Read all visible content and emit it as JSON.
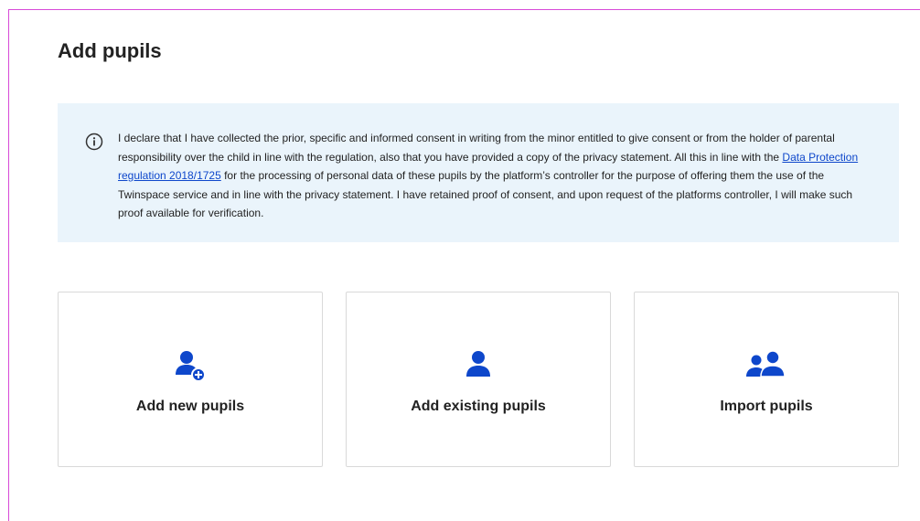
{
  "page": {
    "title": "Add pupils"
  },
  "notice": {
    "icon": "info-circle-icon",
    "text_before_link": "I declare that I have collected the prior, specific and informed consent in writing from the minor entitled to give consent or from the holder of parental responsibility over the child in line with the regulation, also that you have provided a copy of the privacy statement. All this in line with the ",
    "link_text": "Data Protection regulation 2018/1725",
    "text_after_link": " for the processing of personal data of these pupils by the platform’s controller for the purpose of offering them the use of the Twinspace service and in line with the privacy statement. I have retained proof of consent, and upon request of the platforms controller, I will make such proof available for verification."
  },
  "cards": [
    {
      "label": "Add new pupils",
      "icon": "user-plus-icon"
    },
    {
      "label": "Add existing pupils",
      "icon": "user-icon"
    },
    {
      "label": "Import pupils",
      "icon": "users-icon"
    }
  ],
  "colors": {
    "accent": "#0e47cb",
    "notice_bg": "#eaf4fb",
    "card_border": "#d9d9d9",
    "text": "#222222"
  }
}
